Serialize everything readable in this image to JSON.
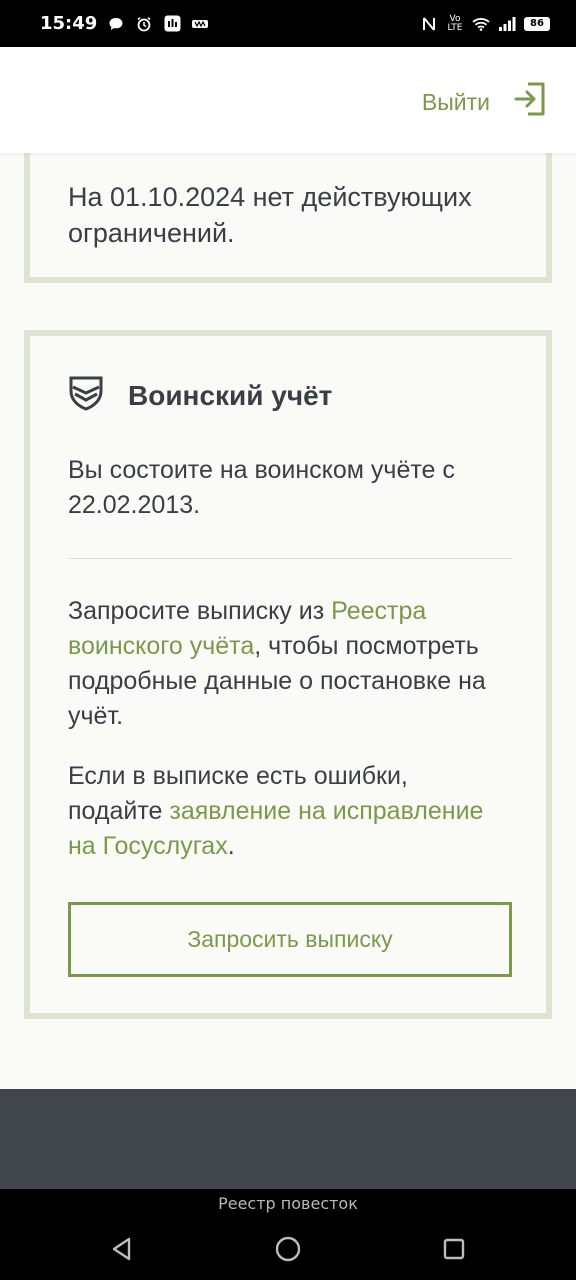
{
  "status_bar": {
    "time": "15:49",
    "network": "Vo LTE",
    "battery": "86",
    "left_icons": [
      "chat-bubble-icon",
      "alarm-clock-icon",
      "app-notification-icon",
      "tools-icon"
    ],
    "right_icons": [
      "nfc-icon",
      "wifi-icon",
      "signal-icon"
    ]
  },
  "header": {
    "logout_label": "Выйти",
    "logout_icon": "logout-icon"
  },
  "restrictions_card": {
    "text": "На 01.10.2024 нет действующих ограничений."
  },
  "military_card": {
    "icon": "shield-icon",
    "title": "Воинский учёт",
    "status_text": "Вы состоите на воинском учёте с 22.02.2013.",
    "request_text": {
      "before": "Запросите выписку из ",
      "link": "Реестра воинского учёта",
      "after": ", чтобы посмотреть подробные данные о постановке на учёт."
    },
    "errors_text": {
      "before": "Если в выписке есть ошибки, подайте ",
      "link": "заявление на исправление на Госуслугах",
      "after": "."
    },
    "button_label": "Запросить выписку"
  },
  "nav_bar": {
    "title": "Реестр повесток",
    "buttons": [
      "back-icon",
      "home-icon",
      "recents-icon"
    ]
  },
  "colors": {
    "accent": "#7a9a4a",
    "card_border": "#dfe3d2",
    "background": "#fafaf6",
    "footer": "#41464d",
    "text": "#3a3f46"
  }
}
